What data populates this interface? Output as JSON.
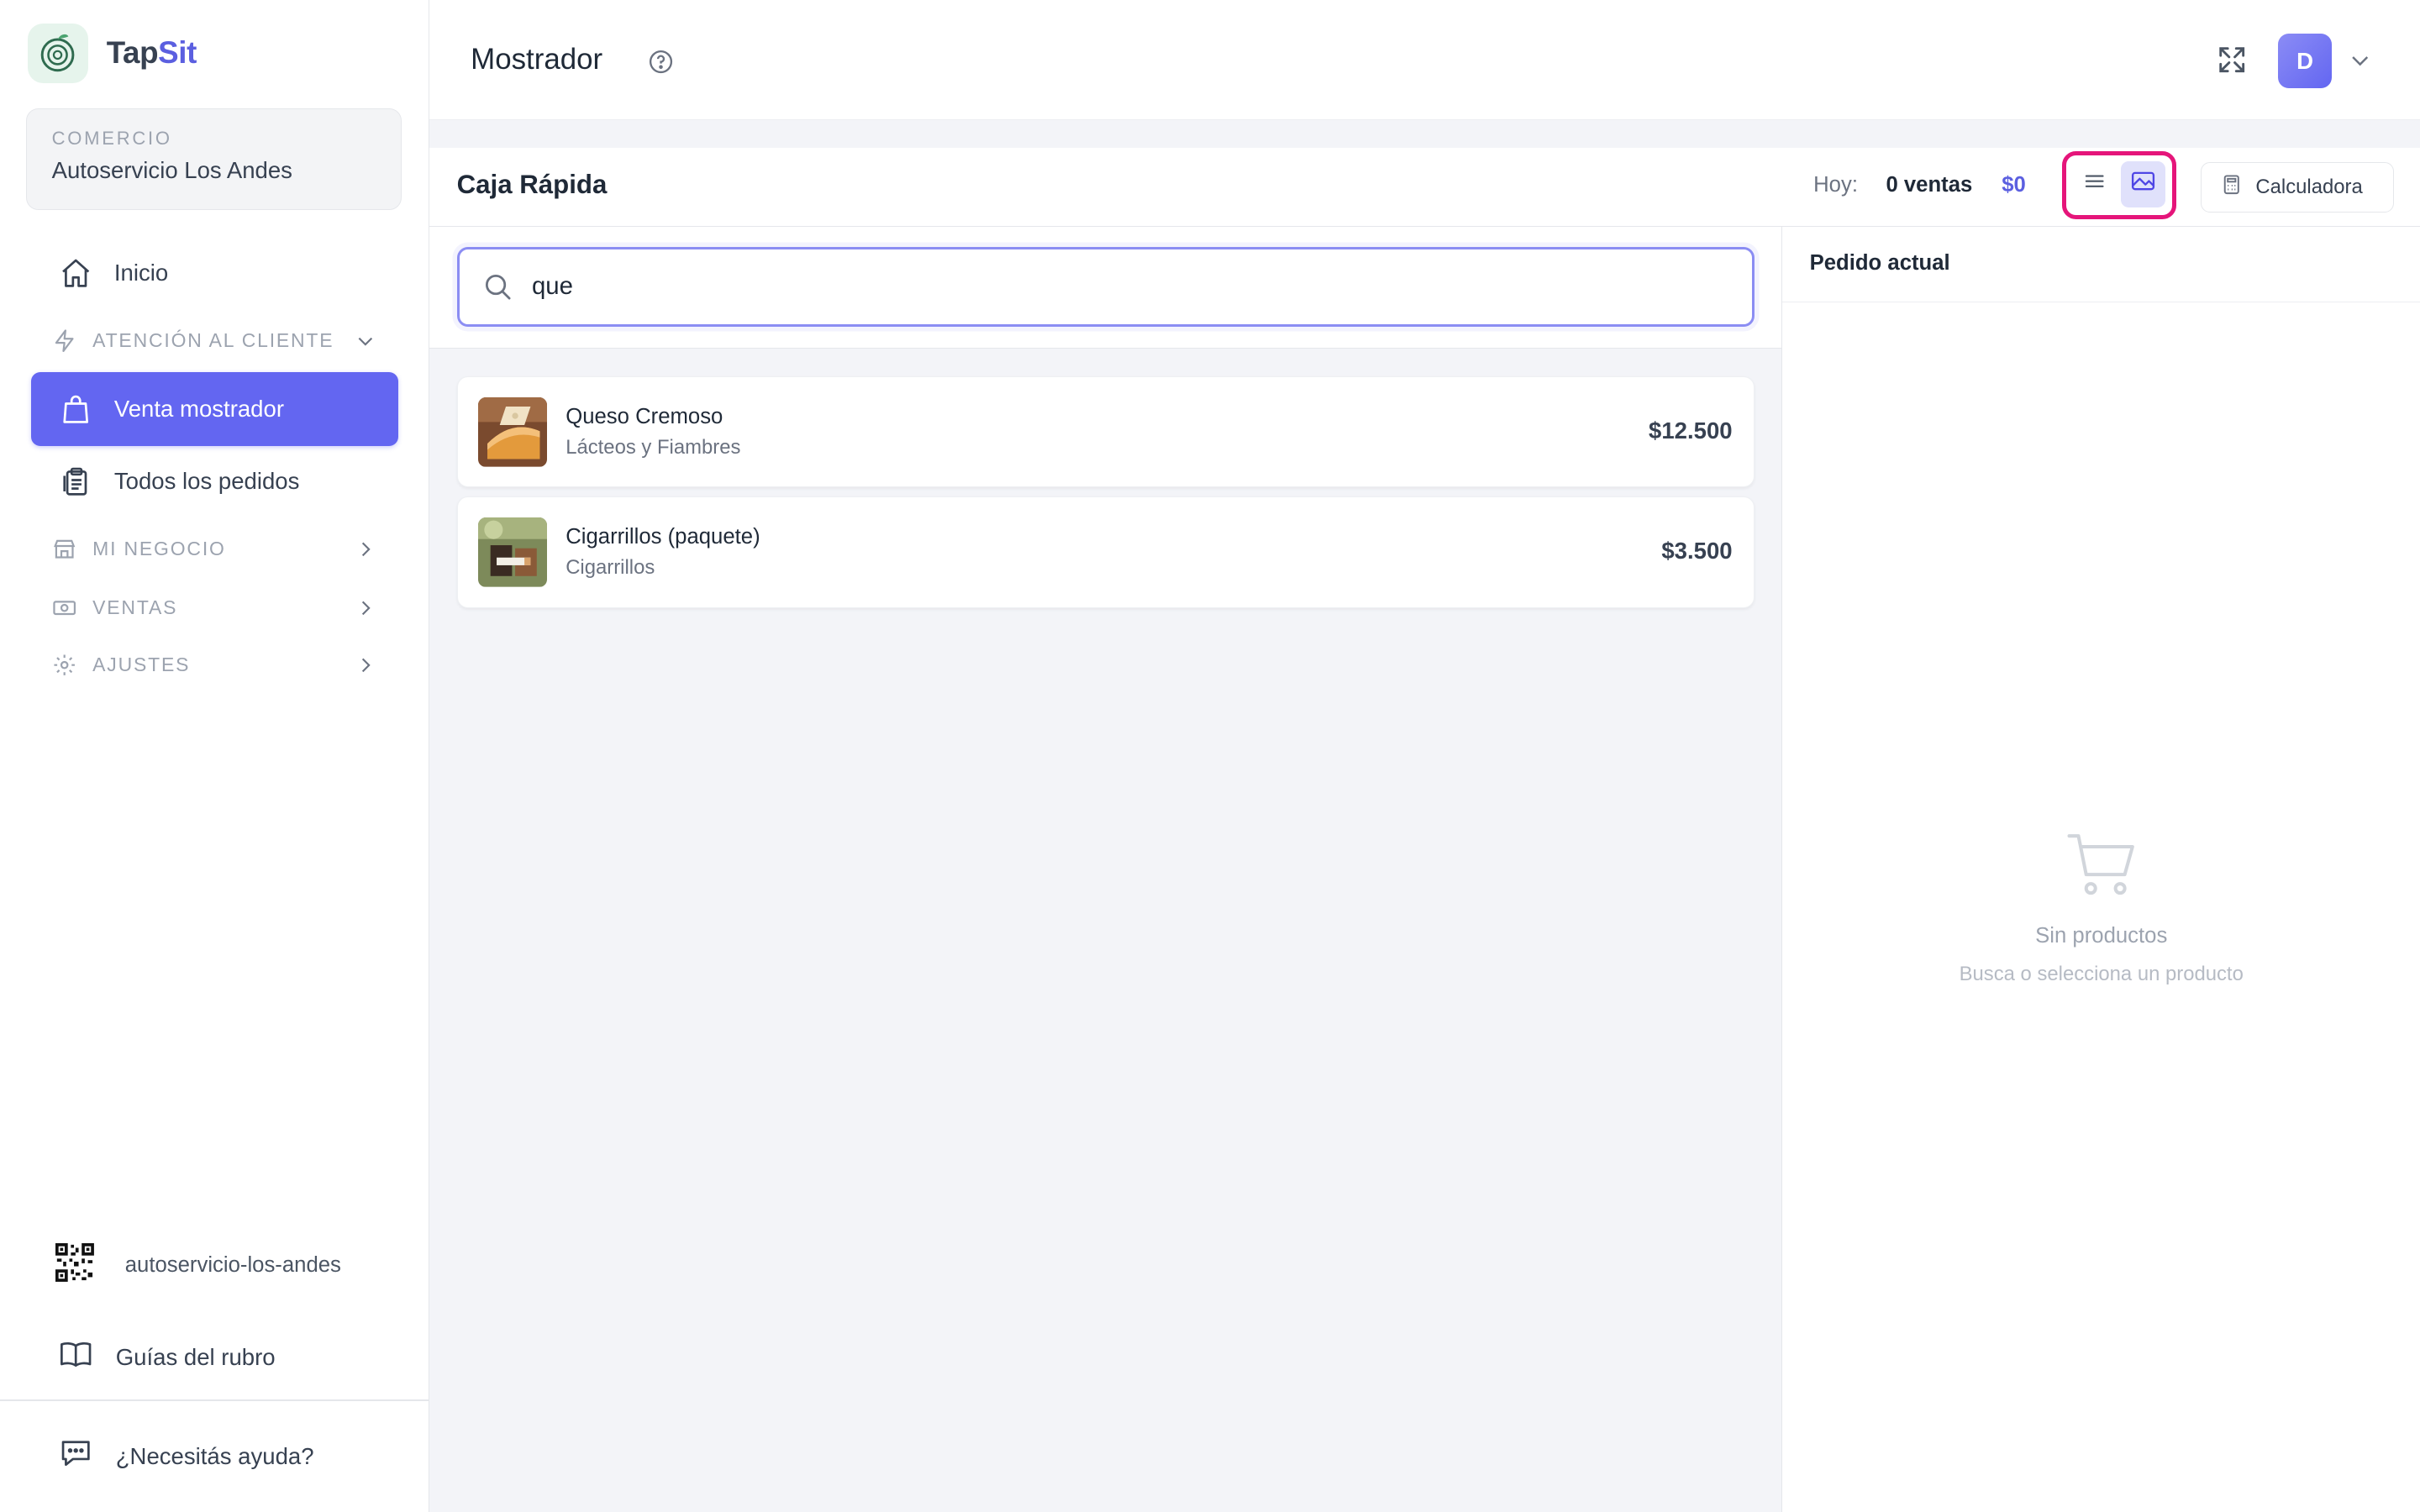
{
  "brand": {
    "name_prefix": "Tap",
    "name_suffix": "Sit",
    "accent_color": "#5b5fe0"
  },
  "commerce": {
    "label": "COMERCIO",
    "name": "Autoservicio Los Andes"
  },
  "nav": {
    "inicio": "Inicio",
    "atencion": "ATENCIÓN AL CLIENTE",
    "venta_mostrador": "Venta mostrador",
    "todos_pedidos": "Todos los pedidos",
    "mi_negocio": "MI NEGOCIO",
    "ventas": "VENTAS",
    "ajustes": "AJUSTES",
    "active_color": "#6366f1"
  },
  "sidebar_footer": {
    "slug": "autoservicio-los-andes",
    "guias": "Guías del rubro",
    "ayuda": "¿Necesitás ayuda?"
  },
  "header": {
    "title": "Mostrador",
    "avatar_initial": "D"
  },
  "toolbar": {
    "title": "Caja Rápida",
    "today_label": "Hoy:",
    "sales_count": "0 ventas",
    "sales_total": "$0",
    "calculator": "Calculadora",
    "highlight_color": "#e5157a"
  },
  "search": {
    "value": "que"
  },
  "products": [
    {
      "name": "Queso Cremoso",
      "category": "Lácteos y Fiambres",
      "price": "$12.500",
      "thumb_icon": "cheese-icon"
    },
    {
      "name": "Cigarrillos (paquete)",
      "category": "Cigarrillos",
      "price": "$3.500",
      "thumb_icon": "cigarettes-icon"
    }
  ],
  "order": {
    "title": "Pedido actual",
    "empty_title": "Sin productos",
    "empty_sub": "Busca o selecciona un producto"
  }
}
